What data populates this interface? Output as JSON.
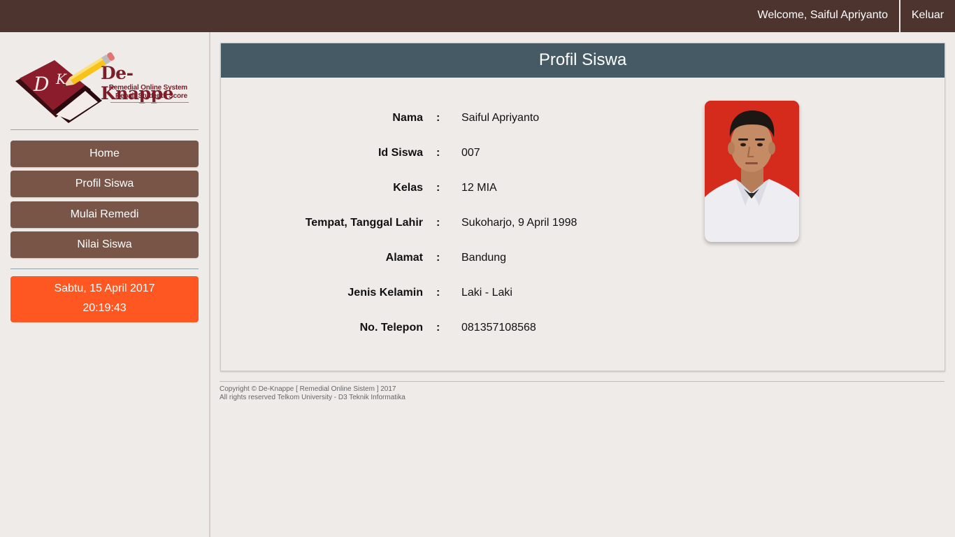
{
  "topbar": {
    "welcome_text": "Welcome, Saiful Apriyanto",
    "logout_label": "Keluar"
  },
  "sidebar": {
    "logo": {
      "title": "De-Knappe",
      "subtitle_line1": "Remedial Online System",
      "subtitle_line2": "Repair Students Score",
      "initials": "DK"
    },
    "nav_items": [
      {
        "label": "Home"
      },
      {
        "label": "Profil Siswa"
      },
      {
        "label": "Mulai Remedi"
      },
      {
        "label": "Nilai Siswa"
      }
    ],
    "clock": {
      "date": "Sabtu, 15 April 2017",
      "time": "20:19:43"
    }
  },
  "profile": {
    "title": "Profil Siswa",
    "separator": ":",
    "fields": [
      {
        "label": "Nama",
        "value": "Saiful Apriyanto"
      },
      {
        "label": "Id Siswa",
        "value": "007"
      },
      {
        "label": "Kelas",
        "value": "12 MIA"
      },
      {
        "label": "Tempat, Tanggal Lahir",
        "value": "Sukoharjo, 9 April 1998"
      },
      {
        "label": "Alamat",
        "value": "Bandung"
      },
      {
        "label": "Jenis Kelamin",
        "value": "Laki - Laki"
      },
      {
        "label": "No. Telepon",
        "value": "081357108568"
      }
    ]
  },
  "footer": {
    "line1": "Copyright © De-Knappe [ Remedial Online Sistem ] 2017",
    "line2": "All rights reserved Telkom University - D3 Teknik Informatika"
  },
  "colors": {
    "topbar": "#4e342e",
    "nav_button": "#795548",
    "clock": "#ff5722",
    "card_header": "#455a64",
    "page_background": "#efebe9"
  }
}
